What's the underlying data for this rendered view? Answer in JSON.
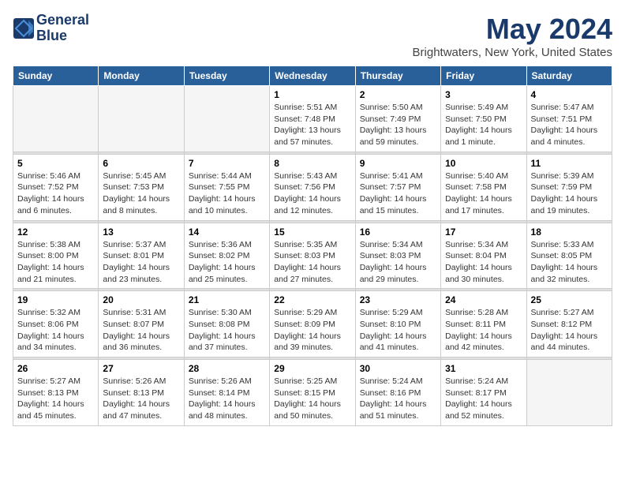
{
  "header": {
    "logo_line1": "General",
    "logo_line2": "Blue",
    "month_title": "May 2024",
    "location": "Brightwaters, New York, United States"
  },
  "days_of_week": [
    "Sunday",
    "Monday",
    "Tuesday",
    "Wednesday",
    "Thursday",
    "Friday",
    "Saturday"
  ],
  "weeks": [
    [
      {
        "day": "",
        "info": ""
      },
      {
        "day": "",
        "info": ""
      },
      {
        "day": "",
        "info": ""
      },
      {
        "day": "1",
        "info": "Sunrise: 5:51 AM\nSunset: 7:48 PM\nDaylight: 13 hours\nand 57 minutes."
      },
      {
        "day": "2",
        "info": "Sunrise: 5:50 AM\nSunset: 7:49 PM\nDaylight: 13 hours\nand 59 minutes."
      },
      {
        "day": "3",
        "info": "Sunrise: 5:49 AM\nSunset: 7:50 PM\nDaylight: 14 hours\nand 1 minute."
      },
      {
        "day": "4",
        "info": "Sunrise: 5:47 AM\nSunset: 7:51 PM\nDaylight: 14 hours\nand 4 minutes."
      }
    ],
    [
      {
        "day": "5",
        "info": "Sunrise: 5:46 AM\nSunset: 7:52 PM\nDaylight: 14 hours\nand 6 minutes."
      },
      {
        "day": "6",
        "info": "Sunrise: 5:45 AM\nSunset: 7:53 PM\nDaylight: 14 hours\nand 8 minutes."
      },
      {
        "day": "7",
        "info": "Sunrise: 5:44 AM\nSunset: 7:55 PM\nDaylight: 14 hours\nand 10 minutes."
      },
      {
        "day": "8",
        "info": "Sunrise: 5:43 AM\nSunset: 7:56 PM\nDaylight: 14 hours\nand 12 minutes."
      },
      {
        "day": "9",
        "info": "Sunrise: 5:41 AM\nSunset: 7:57 PM\nDaylight: 14 hours\nand 15 minutes."
      },
      {
        "day": "10",
        "info": "Sunrise: 5:40 AM\nSunset: 7:58 PM\nDaylight: 14 hours\nand 17 minutes."
      },
      {
        "day": "11",
        "info": "Sunrise: 5:39 AM\nSunset: 7:59 PM\nDaylight: 14 hours\nand 19 minutes."
      }
    ],
    [
      {
        "day": "12",
        "info": "Sunrise: 5:38 AM\nSunset: 8:00 PM\nDaylight: 14 hours\nand 21 minutes."
      },
      {
        "day": "13",
        "info": "Sunrise: 5:37 AM\nSunset: 8:01 PM\nDaylight: 14 hours\nand 23 minutes."
      },
      {
        "day": "14",
        "info": "Sunrise: 5:36 AM\nSunset: 8:02 PM\nDaylight: 14 hours\nand 25 minutes."
      },
      {
        "day": "15",
        "info": "Sunrise: 5:35 AM\nSunset: 8:03 PM\nDaylight: 14 hours\nand 27 minutes."
      },
      {
        "day": "16",
        "info": "Sunrise: 5:34 AM\nSunset: 8:03 PM\nDaylight: 14 hours\nand 29 minutes."
      },
      {
        "day": "17",
        "info": "Sunrise: 5:34 AM\nSunset: 8:04 PM\nDaylight: 14 hours\nand 30 minutes."
      },
      {
        "day": "18",
        "info": "Sunrise: 5:33 AM\nSunset: 8:05 PM\nDaylight: 14 hours\nand 32 minutes."
      }
    ],
    [
      {
        "day": "19",
        "info": "Sunrise: 5:32 AM\nSunset: 8:06 PM\nDaylight: 14 hours\nand 34 minutes."
      },
      {
        "day": "20",
        "info": "Sunrise: 5:31 AM\nSunset: 8:07 PM\nDaylight: 14 hours\nand 36 minutes."
      },
      {
        "day": "21",
        "info": "Sunrise: 5:30 AM\nSunset: 8:08 PM\nDaylight: 14 hours\nand 37 minutes."
      },
      {
        "day": "22",
        "info": "Sunrise: 5:29 AM\nSunset: 8:09 PM\nDaylight: 14 hours\nand 39 minutes."
      },
      {
        "day": "23",
        "info": "Sunrise: 5:29 AM\nSunset: 8:10 PM\nDaylight: 14 hours\nand 41 minutes."
      },
      {
        "day": "24",
        "info": "Sunrise: 5:28 AM\nSunset: 8:11 PM\nDaylight: 14 hours\nand 42 minutes."
      },
      {
        "day": "25",
        "info": "Sunrise: 5:27 AM\nSunset: 8:12 PM\nDaylight: 14 hours\nand 44 minutes."
      }
    ],
    [
      {
        "day": "26",
        "info": "Sunrise: 5:27 AM\nSunset: 8:13 PM\nDaylight: 14 hours\nand 45 minutes."
      },
      {
        "day": "27",
        "info": "Sunrise: 5:26 AM\nSunset: 8:13 PM\nDaylight: 14 hours\nand 47 minutes."
      },
      {
        "day": "28",
        "info": "Sunrise: 5:26 AM\nSunset: 8:14 PM\nDaylight: 14 hours\nand 48 minutes."
      },
      {
        "day": "29",
        "info": "Sunrise: 5:25 AM\nSunset: 8:15 PM\nDaylight: 14 hours\nand 50 minutes."
      },
      {
        "day": "30",
        "info": "Sunrise: 5:24 AM\nSunset: 8:16 PM\nDaylight: 14 hours\nand 51 minutes."
      },
      {
        "day": "31",
        "info": "Sunrise: 5:24 AM\nSunset: 8:17 PM\nDaylight: 14 hours\nand 52 minutes."
      },
      {
        "day": "",
        "info": ""
      }
    ]
  ]
}
